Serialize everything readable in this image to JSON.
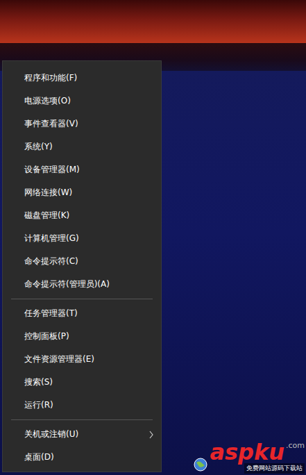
{
  "menu": {
    "sections": [
      {
        "items": [
          {
            "label": "程序和功能(F)",
            "submenu": false
          },
          {
            "label": "电源选项(O)",
            "submenu": false
          },
          {
            "label": "事件查看器(V)",
            "submenu": false
          },
          {
            "label": "系统(Y)",
            "submenu": false
          },
          {
            "label": "设备管理器(M)",
            "submenu": false
          },
          {
            "label": "网络连接(W)",
            "submenu": false
          },
          {
            "label": "磁盘管理(K)",
            "submenu": false
          },
          {
            "label": "计算机管理(G)",
            "submenu": false
          },
          {
            "label": "命令提示符(C)",
            "submenu": false
          },
          {
            "label": "命令提示符(管理员)(A)",
            "submenu": false
          }
        ]
      },
      {
        "items": [
          {
            "label": "任务管理器(T)",
            "submenu": false
          },
          {
            "label": "控制面板(P)",
            "submenu": false
          },
          {
            "label": "文件资源管理器(E)",
            "submenu": false
          },
          {
            "label": "搜索(S)",
            "submenu": false
          },
          {
            "label": "运行(R)",
            "submenu": false
          }
        ]
      },
      {
        "items": [
          {
            "label": "关机或注销(U)",
            "submenu": true
          },
          {
            "label": "桌面(D)",
            "submenu": false
          }
        ]
      }
    ]
  },
  "watermark": {
    "logo": "aspku",
    "suffix": ".com",
    "tagline": "免费网站源码下载站"
  }
}
